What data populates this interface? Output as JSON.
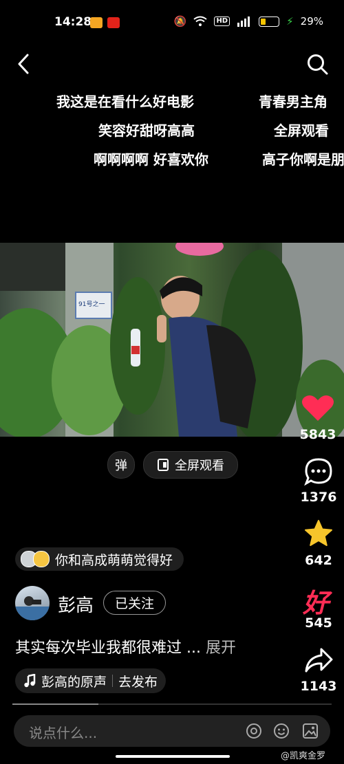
{
  "status_bar": {
    "time": "14:28",
    "battery": "29%",
    "hd": "HD",
    "signal": "4G"
  },
  "danmaku": [
    {
      "text": "我这是在看什么好电影"
    },
    {
      "text": "青春男主角"
    },
    {
      "text": "笑容好甜呀高高"
    },
    {
      "text": "全屏观看"
    },
    {
      "text": "啊啊啊啊 好喜欢你"
    },
    {
      "text": "高子你啊是朋"
    }
  ],
  "video_sign": "91号之一",
  "controls": {
    "danmu_toggle": "弹",
    "fullscreen": "全屏观看"
  },
  "sidebar": {
    "likes": "5843",
    "comments": "1376",
    "favorites": "642",
    "good": "545",
    "good_glyph": "好",
    "shares": "1143"
  },
  "friends_like": "你和高成萌萌觉得好",
  "author": {
    "name": "彭高",
    "follow_label": "已关注"
  },
  "caption": {
    "text": "其实每次毕业我都很难过 ...",
    "expand": "展开"
  },
  "music": {
    "text": "彭高的原声",
    "publish": "去发布"
  },
  "comment_input": {
    "placeholder": "说点什么..."
  },
  "watermark": "@凯爽金罗",
  "colors": {
    "like": "#ff2d55",
    "star": "#f7c52b",
    "good": "#ff2d55",
    "battery": "#f5c400"
  }
}
